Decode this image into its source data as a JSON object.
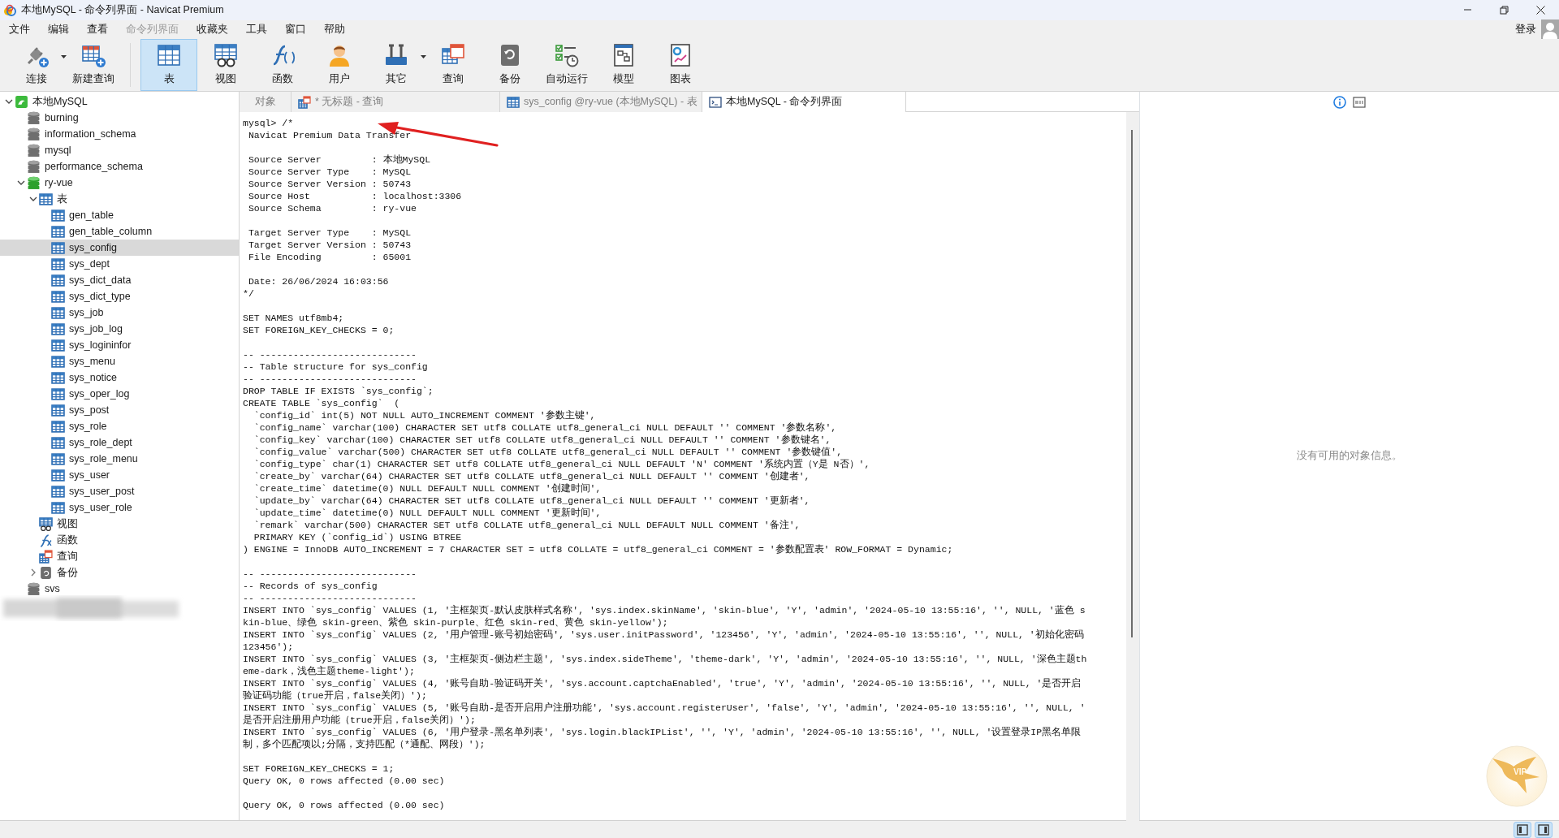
{
  "window": {
    "title": "本地MySQL - 命令列界面 - Navicat Premium"
  },
  "menu": {
    "items": [
      {
        "label": "文件",
        "disabled": false
      },
      {
        "label": "编辑",
        "disabled": false
      },
      {
        "label": "查看",
        "disabled": false
      },
      {
        "label": "命令列界面",
        "disabled": true
      },
      {
        "label": "收藏夹",
        "disabled": false
      },
      {
        "label": "工具",
        "disabled": false
      },
      {
        "label": "窗口",
        "disabled": false
      },
      {
        "label": "帮助",
        "disabled": false
      }
    ],
    "login": "登录"
  },
  "toolbar": {
    "groups": [
      [
        {
          "label": "连接",
          "kind": "connect",
          "dropdown": true,
          "selected": false
        },
        {
          "label": "新建查询",
          "kind": "new_query",
          "dropdown": false,
          "selected": false
        }
      ],
      [
        {
          "label": "表",
          "kind": "table",
          "dropdown": false,
          "selected": true
        },
        {
          "label": "视图",
          "kind": "view",
          "dropdown": false,
          "selected": false
        },
        {
          "label": "函数",
          "kind": "function",
          "dropdown": false,
          "selected": false
        },
        {
          "label": "用户",
          "kind": "user",
          "dropdown": false,
          "selected": false
        },
        {
          "label": "其它",
          "kind": "other",
          "dropdown": true,
          "selected": false
        },
        {
          "label": "查询",
          "kind": "query",
          "dropdown": false,
          "selected": false
        },
        {
          "label": "备份",
          "kind": "backup",
          "dropdown": false,
          "selected": false
        },
        {
          "label": "自动运行",
          "kind": "automation",
          "dropdown": false,
          "selected": false
        },
        {
          "label": "模型",
          "kind": "model",
          "dropdown": false,
          "selected": false
        },
        {
          "label": "图表",
          "kind": "chart",
          "dropdown": false,
          "selected": false
        }
      ]
    ]
  },
  "object_tree": {
    "nodes": [
      {
        "label": "本地MySQL",
        "kind": "connection",
        "expanded": true,
        "selected": false,
        "children": [
          {
            "label": "burning",
            "kind": "database",
            "open": false,
            "selected": false
          },
          {
            "label": "information_schema",
            "kind": "database",
            "open": false,
            "selected": false
          },
          {
            "label": "mysql",
            "kind": "database",
            "open": false,
            "selected": false
          },
          {
            "label": "performance_schema",
            "kind": "database",
            "open": false,
            "selected": false
          },
          {
            "label": "ry-vue",
            "kind": "database",
            "open": true,
            "expanded": true,
            "selected": false,
            "children": [
              {
                "label": "表",
                "kind": "tables",
                "expanded": true,
                "selected": false,
                "children": [
                  {
                    "label": "gen_table",
                    "kind": "table",
                    "selected": false
                  },
                  {
                    "label": "gen_table_column",
                    "kind": "table",
                    "selected": false
                  },
                  {
                    "label": "sys_config",
                    "kind": "table",
                    "selected": true
                  },
                  {
                    "label": "sys_dept",
                    "kind": "table",
                    "selected": false
                  },
                  {
                    "label": "sys_dict_data",
                    "kind": "table",
                    "selected": false
                  },
                  {
                    "label": "sys_dict_type",
                    "kind": "table",
                    "selected": false
                  },
                  {
                    "label": "sys_job",
                    "kind": "table",
                    "selected": false
                  },
                  {
                    "label": "sys_job_log",
                    "kind": "table",
                    "selected": false
                  },
                  {
                    "label": "sys_logininfor",
                    "kind": "table",
                    "selected": false
                  },
                  {
                    "label": "sys_menu",
                    "kind": "table",
                    "selected": false
                  },
                  {
                    "label": "sys_notice",
                    "kind": "table",
                    "selected": false
                  },
                  {
                    "label": "sys_oper_log",
                    "kind": "table",
                    "selected": false
                  },
                  {
                    "label": "sys_post",
                    "kind": "table",
                    "selected": false
                  },
                  {
                    "label": "sys_role",
                    "kind": "table",
                    "selected": false
                  },
                  {
                    "label": "sys_role_dept",
                    "kind": "table",
                    "selected": false
                  },
                  {
                    "label": "sys_role_menu",
                    "kind": "table",
                    "selected": false
                  },
                  {
                    "label": "sys_user",
                    "kind": "table",
                    "selected": false
                  },
                  {
                    "label": "sys_user_post",
                    "kind": "table",
                    "selected": false
                  },
                  {
                    "label": "sys_user_role",
                    "kind": "table",
                    "selected": false
                  }
                ]
              },
              {
                "label": "视图",
                "kind": "views",
                "selected": false
              },
              {
                "label": "函数",
                "kind": "functions",
                "selected": false
              },
              {
                "label": "查询",
                "kind": "queries",
                "selected": false
              },
              {
                "label": "备份",
                "kind": "backups",
                "expanded": false,
                "selected": false
              }
            ]
          },
          {
            "label": "svs",
            "kind": "database",
            "open": false,
            "selected": false
          }
        ]
      }
    ]
  },
  "tabs": [
    {
      "label": "对象",
      "kind": "objects",
      "selected": false
    },
    {
      "label": "* 无标题 - 查询",
      "kind": "query",
      "selected": false
    },
    {
      "label": "sys_config @ry-vue (本地MySQL) - 表",
      "kind": "table",
      "selected": false
    },
    {
      "label": "本地MySQL - 命令列界面",
      "kind": "console",
      "selected": true
    }
  ],
  "console": {
    "blocks": [
      [
        "mysql> /*",
        " Navicat Premium Data Transfer"
      ],
      [
        " Source Server         : 本地MySQL",
        " Source Server Type    : MySQL",
        " Source Server Version : 50743",
        " Source Host           : localhost:3306",
        " Source Schema         : ry-vue"
      ],
      [
        " Target Server Type    : MySQL",
        " Target Server Version : 50743",
        " File Encoding         : 65001"
      ],
      [
        " Date: 26/06/2024 16:03:56",
        "*/"
      ],
      [
        "SET NAMES utf8mb4;",
        "SET FOREIGN_KEY_CHECKS = 0;"
      ],
      [
        "-- ----------------------------",
        "-- Table structure for sys_config",
        "-- ----------------------------",
        "DROP TABLE IF EXISTS `sys_config`;",
        "CREATE TABLE `sys_config`  (",
        "  `config_id` int(5) NOT NULL AUTO_INCREMENT COMMENT '参数主键',",
        "  `config_name` varchar(100) CHARACTER SET utf8 COLLATE utf8_general_ci NULL DEFAULT '' COMMENT '参数名称',",
        "  `config_key` varchar(100) CHARACTER SET utf8 COLLATE utf8_general_ci NULL DEFAULT '' COMMENT '参数键名',",
        "  `config_value` varchar(500) CHARACTER SET utf8 COLLATE utf8_general_ci NULL DEFAULT '' COMMENT '参数键值',",
        "  `config_type` char(1) CHARACTER SET utf8 COLLATE utf8_general_ci NULL DEFAULT 'N' COMMENT '系统内置（Y是 N否）',",
        "  `create_by` varchar(64) CHARACTER SET utf8 COLLATE utf8_general_ci NULL DEFAULT '' COMMENT '创建者',",
        "  `create_time` datetime(0) NULL DEFAULT NULL COMMENT '创建时间',",
        "  `update_by` varchar(64) CHARACTER SET utf8 COLLATE utf8_general_ci NULL DEFAULT '' COMMENT '更新者',",
        "  `update_time` datetime(0) NULL DEFAULT NULL COMMENT '更新时间',",
        "  `remark` varchar(500) CHARACTER SET utf8 COLLATE utf8_general_ci NULL DEFAULT NULL COMMENT '备注',",
        "  PRIMARY KEY (`config_id`) USING BTREE",
        ") ENGINE = InnoDB AUTO_INCREMENT = 7 CHARACTER SET = utf8 COLLATE = utf8_general_ci COMMENT = '参数配置表' ROW_FORMAT = Dynamic;"
      ],
      [
        "-- ----------------------------",
        "-- Records of sys_config",
        "-- ----------------------------",
        "INSERT INTO `sys_config` VALUES (1, '主框架页-默认皮肤样式名称', 'sys.index.skinName', 'skin-blue', 'Y', 'admin', '2024-05-10 13:55:16', '', NULL, '蓝色 s",
        "kin-blue、绿色 skin-green、紫色 skin-purple、红色 skin-red、黄色 skin-yellow');",
        "INSERT INTO `sys_config` VALUES (2, '用户管理-账号初始密码', 'sys.user.initPassword', '123456', 'Y', 'admin', '2024-05-10 13:55:16', '', NULL, '初始化密码",
        "123456');",
        "INSERT INTO `sys_config` VALUES (3, '主框架页-侧边栏主题', 'sys.index.sideTheme', 'theme-dark', 'Y', 'admin', '2024-05-10 13:55:16', '', NULL, '深色主题th",
        "eme-dark，浅色主题theme-light');",
        "INSERT INTO `sys_config` VALUES (4, '账号自助-验证码开关', 'sys.account.captchaEnabled', 'true', 'Y', 'admin', '2024-05-10 13:55:16', '', NULL, '是否开启",
        "验证码功能（true开启，false关闭）');",
        "INSERT INTO `sys_config` VALUES (5, '账号自助-是否开启用户注册功能', 'sys.account.registerUser', 'false', 'Y', 'admin', '2024-05-10 13:55:16', '', NULL, '",
        "是否开启注册用户功能（true开启，false关闭）');",
        "INSERT INTO `sys_config` VALUES (6, '用户登录-黑名单列表', 'sys.login.blackIPList', '', 'Y', 'admin', '2024-05-10 13:55:16', '', NULL, '设置登录IP黑名单限",
        "制，多个匹配项以;分隔，支持匹配（*通配、网段）');"
      ],
      [
        "SET FOREIGN_KEY_CHECKS = 1;",
        "Query OK, 0 rows affected (0.00 sec)"
      ],
      [
        "Query OK, 0 rows affected (0.00 sec)"
      ]
    ]
  },
  "info_panel": {
    "message": "没有可用的对象信息。"
  },
  "floating_badge": {
    "text": "VIP"
  }
}
